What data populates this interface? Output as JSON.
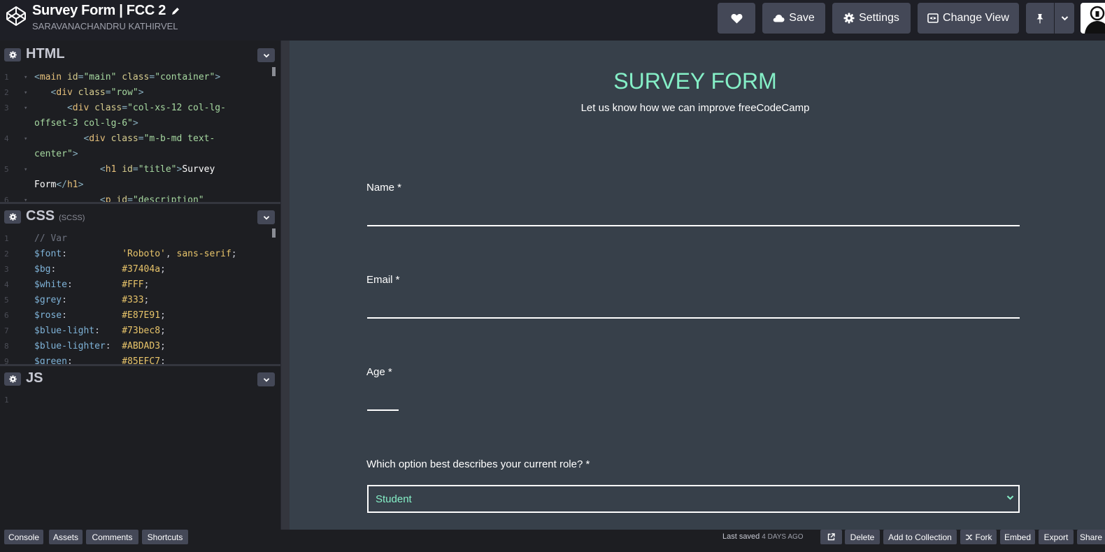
{
  "header": {
    "pen_title": "Survey Form | FCC 2",
    "author": "SARAVANACHANDRU KATHIRVEL",
    "buttons": {
      "save": "Save",
      "settings": "Settings",
      "change_view": "Change View"
    }
  },
  "editors": {
    "html": {
      "name": "HTML"
    },
    "css": {
      "name": "CSS",
      "preprocessor": "(SCSS)"
    },
    "js": {
      "name": "JS"
    }
  },
  "html_code": [
    {
      "n": "1",
      "fold": true,
      "tokens": [
        [
          "br",
          "<"
        ],
        [
          "tag",
          "main"
        ],
        [
          "pl",
          " "
        ],
        [
          "attr",
          "id"
        ],
        [
          "br",
          "="
        ],
        [
          "str",
          "\"main\""
        ],
        [
          "pl",
          " "
        ],
        [
          "attr",
          "class"
        ],
        [
          "br",
          "="
        ],
        [
          "str",
          "\"container\""
        ],
        [
          "br",
          ">"
        ]
      ]
    },
    {
      "n": "2",
      "fold": true,
      "tokens": [
        [
          "pl",
          "   "
        ],
        [
          "br",
          "<"
        ],
        [
          "tag",
          "div"
        ],
        [
          "pl",
          " "
        ],
        [
          "attr",
          "class"
        ],
        [
          "br",
          "="
        ],
        [
          "str",
          "\"row\""
        ],
        [
          "br",
          ">"
        ]
      ]
    },
    {
      "n": "3",
      "fold": true,
      "tokens": [
        [
          "pl",
          "      "
        ],
        [
          "br",
          "<"
        ],
        [
          "tag",
          "div"
        ],
        [
          "pl",
          " "
        ],
        [
          "attr",
          "class"
        ],
        [
          "br",
          "="
        ],
        [
          "str",
          "\"col-xs-12 col-lg-"
        ]
      ]
    },
    {
      "n": "",
      "fold": false,
      "tokens": [
        [
          "str",
          "offset-3 col-lg-6\""
        ],
        [
          "br",
          ">"
        ]
      ]
    },
    {
      "n": "4",
      "fold": true,
      "tokens": [
        [
          "pl",
          "         "
        ],
        [
          "br",
          "<"
        ],
        [
          "tag",
          "div"
        ],
        [
          "pl",
          " "
        ],
        [
          "attr",
          "class"
        ],
        [
          "br",
          "="
        ],
        [
          "str",
          "\"m-b-md text-"
        ]
      ]
    },
    {
      "n": "",
      "fold": false,
      "tokens": [
        [
          "str",
          "center\""
        ],
        [
          "br",
          ">"
        ]
      ]
    },
    {
      "n": "5",
      "fold": true,
      "tokens": [
        [
          "pl",
          "            "
        ],
        [
          "br",
          "<"
        ],
        [
          "tag",
          "h1"
        ],
        [
          "pl",
          " "
        ],
        [
          "attr",
          "id"
        ],
        [
          "br",
          "="
        ],
        [
          "str",
          "\"title\""
        ],
        [
          "br",
          ">"
        ],
        [
          "txt",
          "Survey"
        ]
      ]
    },
    {
      "n": "",
      "fold": false,
      "tokens": [
        [
          "txt",
          "Form"
        ],
        [
          "br",
          "</"
        ],
        [
          "tag",
          "h1"
        ],
        [
          "br",
          ">"
        ]
      ]
    },
    {
      "n": "6",
      "fold": true,
      "tokens": [
        [
          "pl",
          "            "
        ],
        [
          "br",
          "<"
        ],
        [
          "tag",
          "p"
        ],
        [
          "pl",
          " "
        ],
        [
          "attr",
          "id"
        ],
        [
          "br",
          "="
        ],
        [
          "str",
          "\"description\""
        ]
      ]
    }
  ],
  "css_code": [
    {
      "n": "1",
      "tokens": [
        [
          "cm",
          "// Var"
        ]
      ]
    },
    {
      "n": "2",
      "tokens": [
        [
          "var",
          "$font"
        ],
        [
          "pl",
          ":          "
        ],
        [
          "cs",
          "'Roboto'"
        ],
        [
          "pl",
          ", "
        ],
        [
          "cs",
          "sans-serif"
        ],
        [
          "pl",
          ";"
        ]
      ]
    },
    {
      "n": "3",
      "tokens": [
        [
          "var",
          "$bg"
        ],
        [
          "pl",
          ":            "
        ],
        [
          "cs",
          "#37404a"
        ],
        [
          "pl",
          ";"
        ]
      ]
    },
    {
      "n": "4",
      "tokens": [
        [
          "var",
          "$white"
        ],
        [
          "pl",
          ":         "
        ],
        [
          "cs",
          "#FFF"
        ],
        [
          "pl",
          ";"
        ]
      ]
    },
    {
      "n": "5",
      "tokens": [
        [
          "var",
          "$grey"
        ],
        [
          "pl",
          ":          "
        ],
        [
          "cs",
          "#333"
        ],
        [
          "pl",
          ";"
        ]
      ]
    },
    {
      "n": "6",
      "tokens": [
        [
          "var",
          "$rose"
        ],
        [
          "pl",
          ":          "
        ],
        [
          "cs",
          "#E87E91"
        ],
        [
          "pl",
          ";"
        ]
      ]
    },
    {
      "n": "7",
      "tokens": [
        [
          "var",
          "$blue-light"
        ],
        [
          "pl",
          ":    "
        ],
        [
          "cs",
          "#73bec8"
        ],
        [
          "pl",
          ";"
        ]
      ]
    },
    {
      "n": "8",
      "tokens": [
        [
          "var",
          "$blue-lighter"
        ],
        [
          "pl",
          ":  "
        ],
        [
          "cs",
          "#ABDAD3"
        ],
        [
          "pl",
          ";"
        ]
      ]
    },
    {
      "n": "9",
      "tokens": [
        [
          "var",
          "$green"
        ],
        [
          "pl",
          ":         "
        ],
        [
          "cs",
          "#85EFC7"
        ],
        [
          "pl",
          ";"
        ]
      ]
    }
  ],
  "js_code": [
    {
      "n": "1",
      "tokens": []
    }
  ],
  "preview": {
    "title": "SURVEY FORM",
    "description": "Let us know how we can improve freeCodeCamp",
    "name_label": "Name *",
    "email_label": "Email *",
    "age_label": "Age *",
    "role_label": "Which option best describes your current role? *",
    "role_selected": "Student"
  },
  "footer": {
    "console": "Console",
    "assets": "Assets",
    "comments": "Comments",
    "shortcuts": "Shortcuts",
    "last_saved": "Last saved",
    "saved_ago": "4 DAYS AGO",
    "delete": "Delete",
    "add_to_collection": "Add to Collection",
    "fork": "Fork",
    "embed": "Embed",
    "export": "Export",
    "share": "Share"
  },
  "colors": {
    "preview_bg": "#37404a",
    "accent_green": "#85efc7",
    "header_bg": "#1e1f26",
    "button_bg": "#444857"
  },
  "icons": [
    "codepen-logo-icon",
    "pencil-icon",
    "heart-icon",
    "cloud-icon",
    "gear-icon",
    "eye-icon",
    "pin-icon",
    "chevron-down-icon",
    "external-link-icon",
    "fork-icon"
  ]
}
